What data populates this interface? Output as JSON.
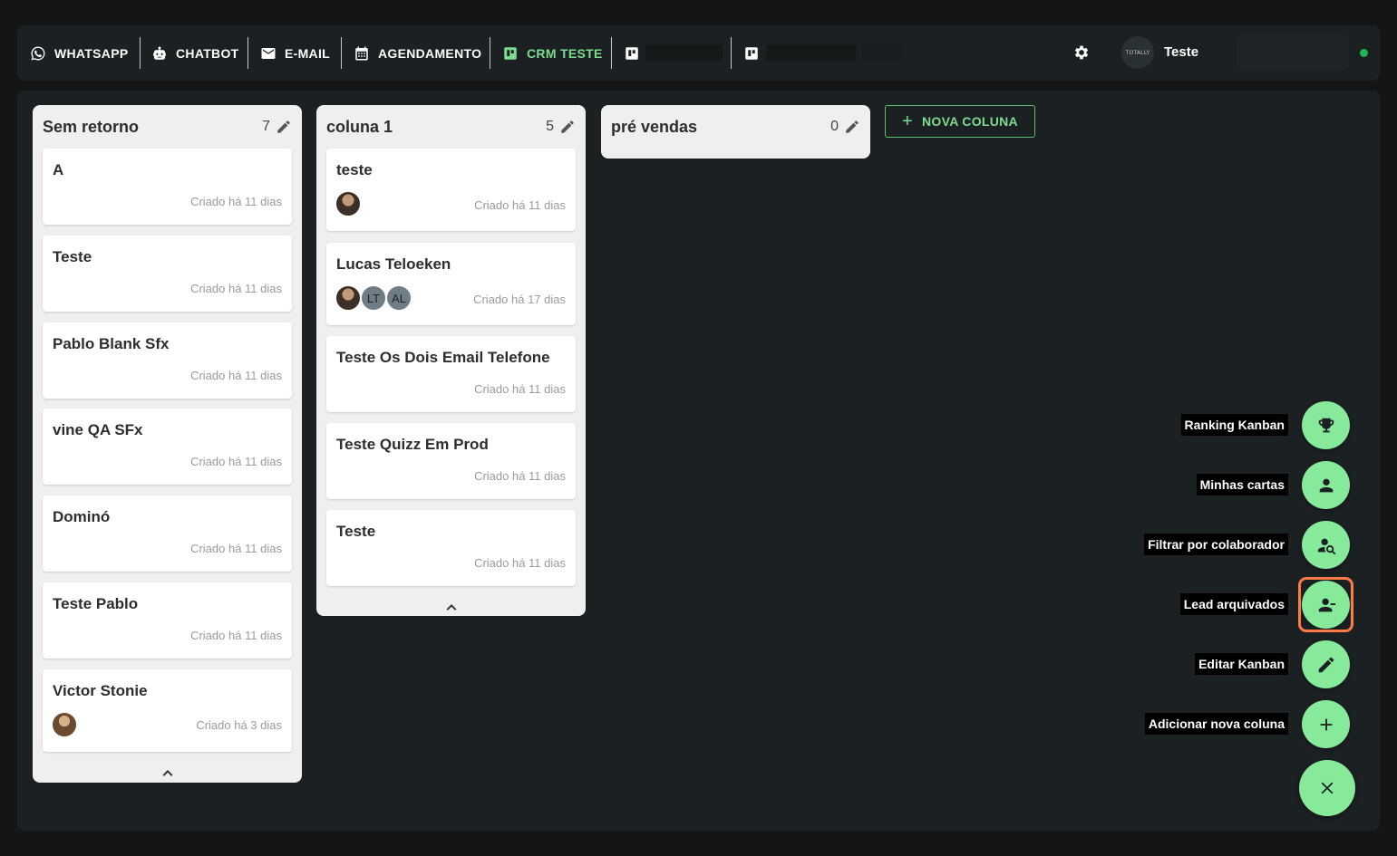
{
  "nav": {
    "items": [
      {
        "label": "WHATSAPP",
        "icon": "whatsapp-icon"
      },
      {
        "label": "CHATBOT",
        "icon": "robot-icon"
      },
      {
        "label": "E-MAIL",
        "icon": "mail-icon"
      },
      {
        "label": "AGENDAMENTO",
        "icon": "calendar-icon"
      },
      {
        "label": "CRM TESTE",
        "icon": "kanban-icon",
        "active": true
      },
      {
        "label": "",
        "icon": "kanban-icon"
      },
      {
        "label": "",
        "icon": "kanban-icon"
      }
    ],
    "settings_icon": "gear-icon",
    "logo_text": "TOTALLY",
    "user_name": "Teste",
    "status_color": "#1db954"
  },
  "board": {
    "new_column_label": "NOVA COLUNA",
    "columns": [
      {
        "title": "Sem retorno",
        "count": "7",
        "cards": [
          {
            "title": "A",
            "date": "Criado há 11 dias"
          },
          {
            "title": "Teste",
            "date": "Criado há 11 dias"
          },
          {
            "title": "Pablo Blank Sfx",
            "date": "Criado há 11 dias"
          },
          {
            "title": "vine QA SFx",
            "date": "Criado há 11 dias"
          },
          {
            "title": "Dominó",
            "date": "Criado há 11 dias"
          },
          {
            "title": "Teste Pablo",
            "date": "Criado há 11 dias"
          },
          {
            "title": "Victor Stonie",
            "date": "Criado há 3 dias",
            "avatars": [
              "photo"
            ]
          }
        ]
      },
      {
        "title": "coluna 1",
        "count": "5",
        "cards": [
          {
            "title": "teste",
            "date": "Criado há 11 dias",
            "avatars": [
              "photo"
            ]
          },
          {
            "title": "Lucas Teloeken",
            "date": "Criado há 17 dias",
            "avatars": [
              "photo",
              "LT",
              "AL"
            ]
          },
          {
            "title": "Teste Os Dois Email Telefone",
            "date": "Criado há 11 dias"
          },
          {
            "title": "Teste Quizz Em Prod",
            "date": "Criado há 11 dias"
          },
          {
            "title": "Teste",
            "date": "Criado há 11 dias"
          }
        ]
      },
      {
        "title": "pré vendas",
        "count": "0",
        "cards": []
      }
    ]
  },
  "speed_dial": {
    "actions": [
      {
        "label": "Ranking Kanban",
        "icon": "trophy-icon"
      },
      {
        "label": "Minhas cartas",
        "icon": "person-icon"
      },
      {
        "label": "Filtrar por colaborador",
        "icon": "person-search-icon"
      },
      {
        "label": "Lead arquivados",
        "icon": "person-remove-icon",
        "highlighted": true
      },
      {
        "label": "Editar Kanban",
        "icon": "pencil-icon"
      },
      {
        "label": "Adicionar nova coluna",
        "icon": "plus-icon"
      }
    ],
    "close_icon": "close-icon",
    "accent": "#86ea9a",
    "highlight_color": "#ff7a45"
  }
}
